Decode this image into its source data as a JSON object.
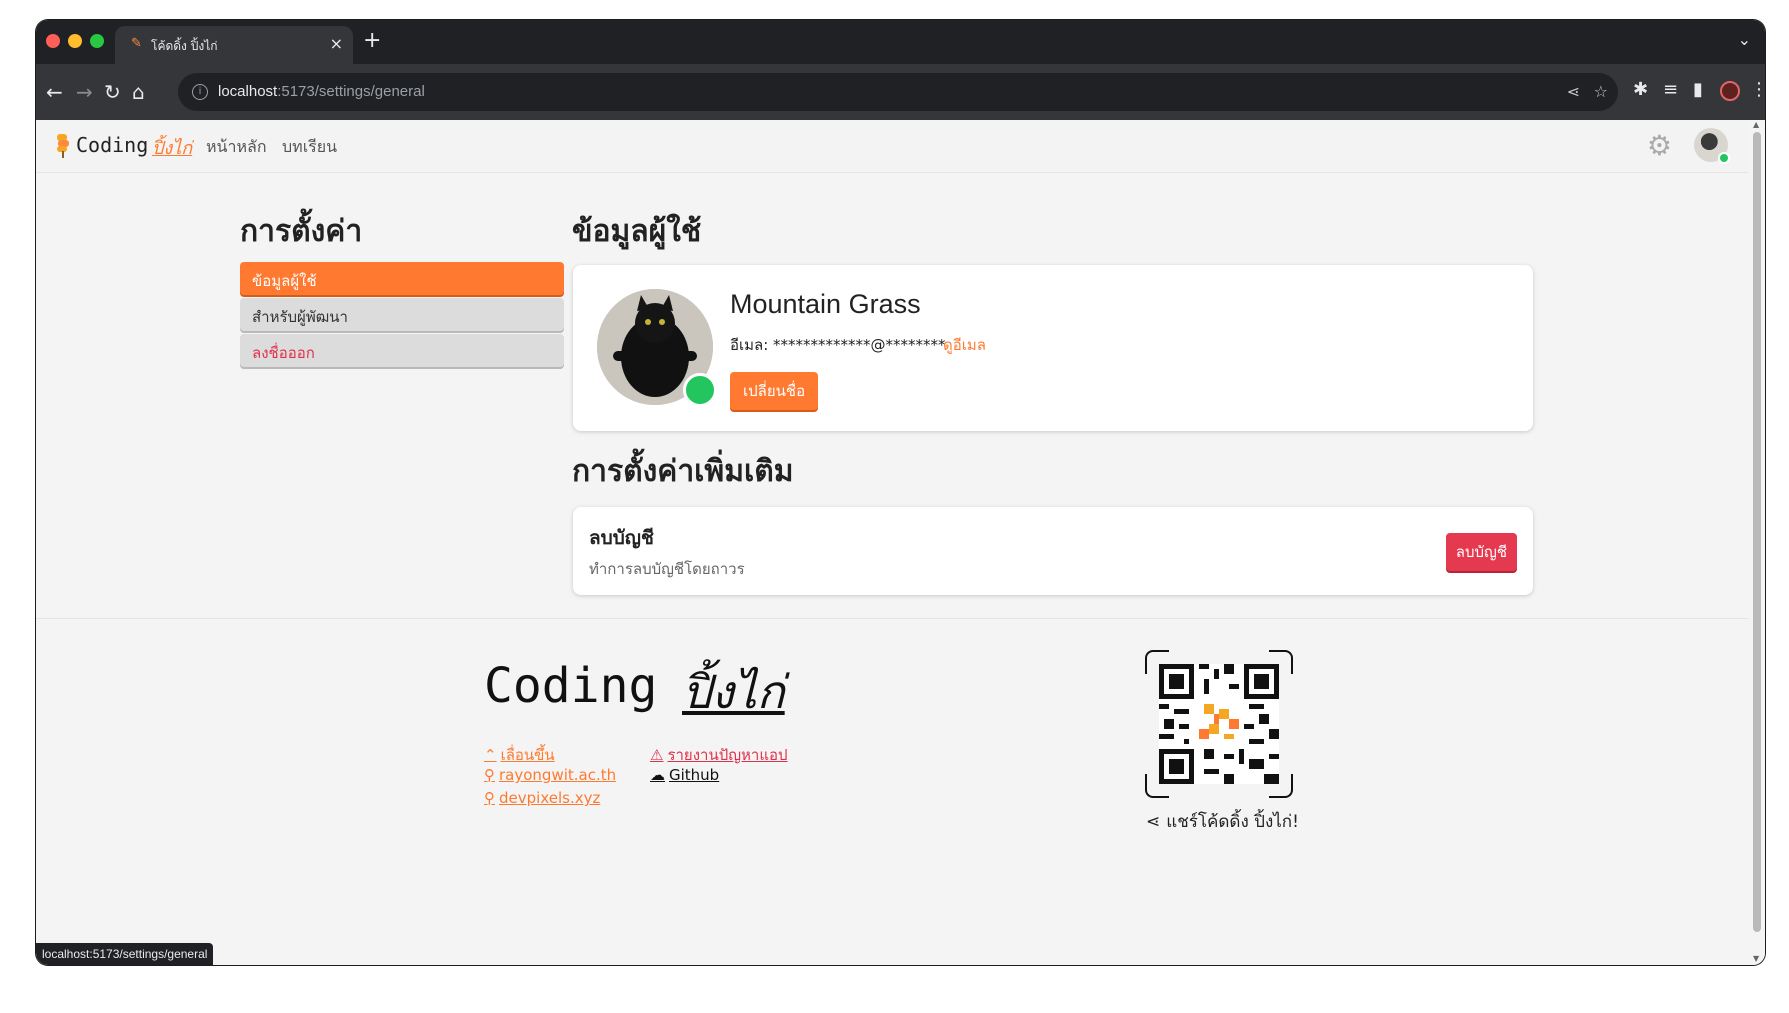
{
  "browser": {
    "tab_title": "โค้ดดิ้ง ปิ้งไก่",
    "tab_favicon": "skewer-icon",
    "url_host": "localhost",
    "url_rest": ":5173/settings/general",
    "status_url": "localhost:5173/settings/general"
  },
  "navbar": {
    "logo_text": "Coding",
    "logo_accent": "ปิ้งไก่",
    "links": [
      "หน้าหลัก",
      "บทเรียน"
    ]
  },
  "sidebar": {
    "heading": "การตั้งค่า",
    "items": [
      {
        "label": "ข้อมูลผู้ใช้",
        "state": "active"
      },
      {
        "label": "สำหรับผู้พัฒนา",
        "state": "normal"
      },
      {
        "label": "ลงชื่อออก",
        "state": "danger"
      }
    ]
  },
  "profile": {
    "heading": "ข้อมูลผู้ใช้",
    "name": "Mountain Grass",
    "email_label": "อีเมล: *************@********",
    "email_link": "ดูอีเมล",
    "rename_button": "เปลี่ยนชื่อ"
  },
  "more_settings": {
    "heading": "การตั้งค่าเพิ่มเติม",
    "delete_title": "ลบบัญชี",
    "delete_desc": "ทำการลบบัญชีโดยถาวร",
    "delete_button": "ลบบัญชี"
  },
  "footer": {
    "logo_text": "Coding",
    "logo_accent": "ปิ้งไก่",
    "links_left": [
      {
        "icon": "chevrons-up-icon",
        "label": "เลื่อนขึ้น"
      },
      {
        "icon": "link-icon",
        "label": "rayongwit.ac.th"
      },
      {
        "icon": "link-icon",
        "label": "devpixels.xyz"
      }
    ],
    "links_right": [
      {
        "icon": "warning-icon",
        "label": "รายงานปัญหาแอป"
      },
      {
        "icon": "github-icon",
        "label": "Github"
      }
    ],
    "share_text": "แชร์โค้ดดิ้ง ปิ้งไก่!"
  },
  "colors": {
    "accent": "#ff7a30",
    "danger": "#e53950",
    "online": "#22c55e"
  }
}
